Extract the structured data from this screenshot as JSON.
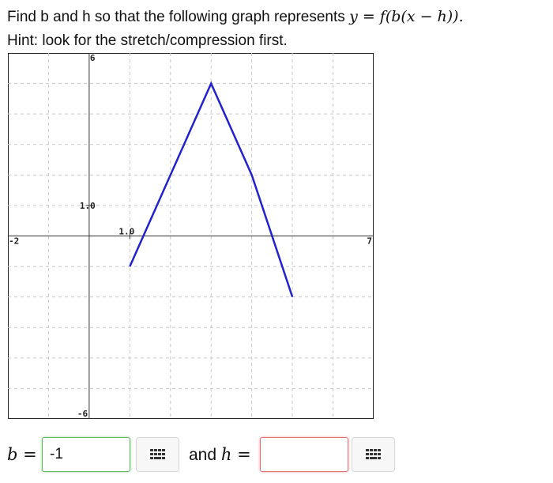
{
  "question": {
    "line1_text": "Find b and h so that the following graph represents ",
    "line1_math": "y = f(b(x − h)).",
    "line2": "Hint: look for the stretch/compression first."
  },
  "chart_data": {
    "type": "line",
    "xlim": [
      -2,
      7
    ],
    "ylim": [
      -6,
      6
    ],
    "grid": true,
    "grid_step": 1,
    "x_tick_labels": [
      "-2",
      "7",
      "1.0"
    ],
    "y_tick_labels": [
      "6",
      "-6",
      "1.0"
    ],
    "series": [
      {
        "x": [
          1,
          3,
          4,
          5
        ],
        "y": [
          -1,
          5,
          2,
          -2
        ],
        "color": "#2222cc"
      }
    ]
  },
  "answers": {
    "b_label": "b =",
    "b_value": "-1",
    "and_h_label": "and h =",
    "h_value": ""
  },
  "icons": {
    "keyboard_button": "grid-keypad-icon"
  }
}
